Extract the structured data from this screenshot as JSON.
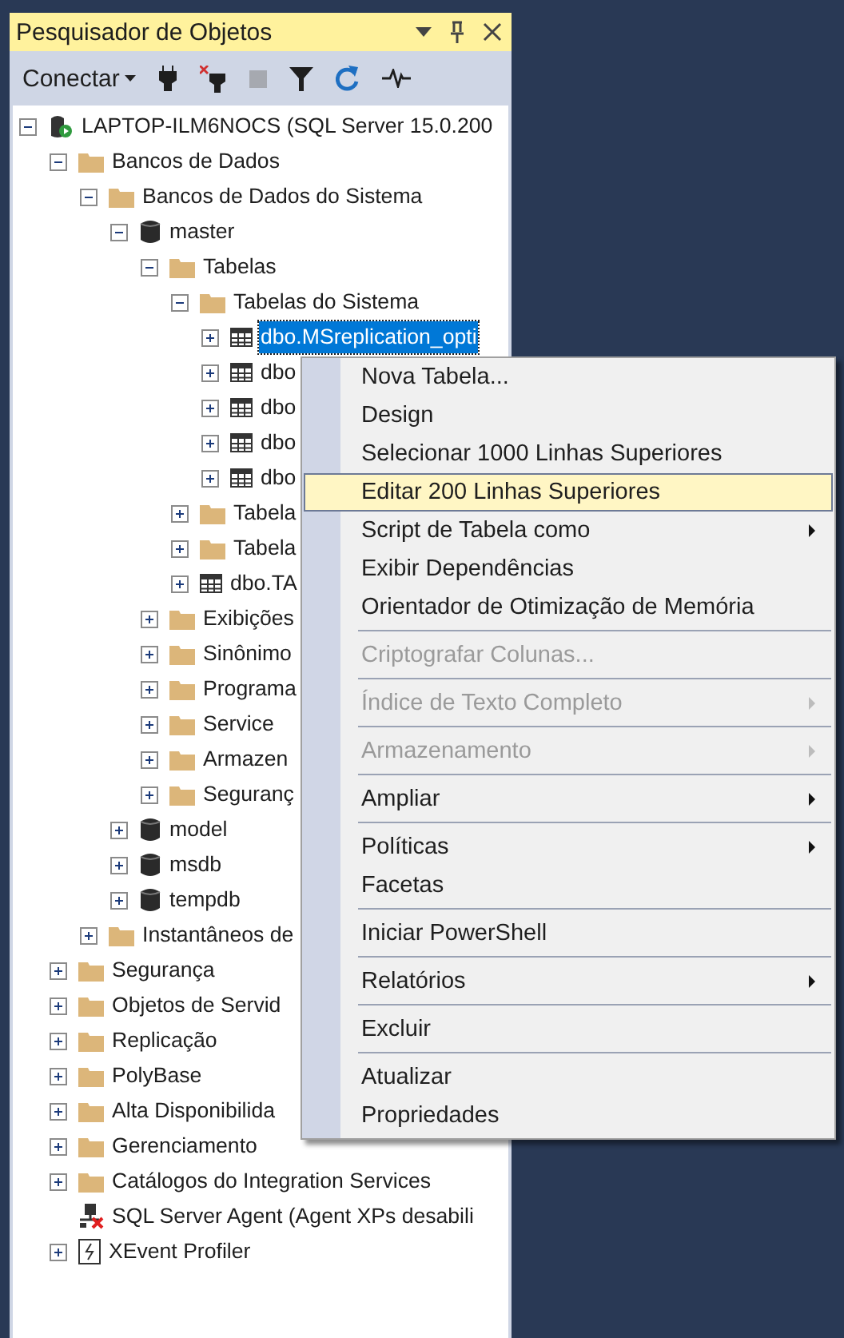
{
  "panel": {
    "title": "Pesquisador de Objetos"
  },
  "toolbar": {
    "connect_label": "Conectar",
    "tools": [
      {
        "kind": "plug"
      },
      {
        "kind": "unplug"
      },
      {
        "kind": "stop",
        "disabled": true
      },
      {
        "kind": "filter"
      },
      {
        "kind": "refresh"
      },
      {
        "kind": "activity"
      }
    ]
  },
  "tree": [
    {
      "label": "LAPTOP-ILM6NOCS (SQL Server 15.0.200",
      "kind": "server",
      "expanded": true,
      "selected": false,
      "children": [
        {
          "label": "Bancos de Dados",
          "kind": "folder",
          "expanded": true,
          "selected": false,
          "children": [
            {
              "label": "Bancos de Dados do Sistema",
              "kind": "folder",
              "expanded": true,
              "selected": false,
              "children": [
                {
                  "label": "master",
                  "kind": "database",
                  "expanded": true,
                  "selected": false,
                  "children": [
                    {
                      "label": "Tabelas",
                      "kind": "folder",
                      "expanded": true,
                      "selected": false,
                      "children": [
                        {
                          "label": "Tabelas do Sistema",
                          "kind": "folder",
                          "expanded": true,
                          "selected": false,
                          "children": [
                            {
                              "label": "dbo.MSreplication_opti",
                              "kind": "table",
                              "expanded": false,
                              "selected": true
                            },
                            {
                              "label": "dbo",
                              "kind": "table",
                              "expanded": false,
                              "selected": false
                            },
                            {
                              "label": "dbo",
                              "kind": "table",
                              "expanded": false,
                              "selected": false
                            },
                            {
                              "label": "dbo",
                              "kind": "table",
                              "expanded": false,
                              "selected": false
                            },
                            {
                              "label": "dbo",
                              "kind": "table",
                              "expanded": false,
                              "selected": false
                            }
                          ]
                        },
                        {
                          "label": "Tabela",
                          "kind": "folder",
                          "expanded": false,
                          "selected": false
                        },
                        {
                          "label": "Tabela",
                          "kind": "folder",
                          "expanded": false,
                          "selected": false
                        },
                        {
                          "label": "dbo.TA",
                          "kind": "table",
                          "expanded": false,
                          "selected": false
                        }
                      ]
                    },
                    {
                      "label": "Exibições",
                      "kind": "folder",
                      "expanded": false,
                      "selected": false
                    },
                    {
                      "label": "Sinônimo",
                      "kind": "folder",
                      "expanded": false,
                      "selected": false
                    },
                    {
                      "label": "Programa",
                      "kind": "folder",
                      "expanded": false,
                      "selected": false
                    },
                    {
                      "label": "Service",
                      "kind": "folder",
                      "expanded": false,
                      "selected": false
                    },
                    {
                      "label": "Armazen",
                      "kind": "folder",
                      "expanded": false,
                      "selected": false
                    },
                    {
                      "label": "Seguranç",
                      "kind": "folder",
                      "expanded": false,
                      "selected": false
                    }
                  ]
                },
                {
                  "label": "model",
                  "kind": "database",
                  "expanded": false,
                  "selected": false
                },
                {
                  "label": "msdb",
                  "kind": "database",
                  "expanded": false,
                  "selected": false
                },
                {
                  "label": "tempdb",
                  "kind": "database",
                  "expanded": false,
                  "selected": false
                }
              ]
            },
            {
              "label": "Instantâneos de",
              "kind": "folder",
              "expanded": false,
              "selected": false
            }
          ]
        },
        {
          "label": "Segurança",
          "kind": "folder",
          "expanded": false,
          "selected": false
        },
        {
          "label": "Objetos de Servid",
          "kind": "folder",
          "expanded": false,
          "selected": false
        },
        {
          "label": "Replicação",
          "kind": "folder",
          "expanded": false,
          "selected": false
        },
        {
          "label": "PolyBase",
          "kind": "folder",
          "expanded": false,
          "selected": false
        },
        {
          "label": "Alta Disponibilida",
          "kind": "folder",
          "expanded": false,
          "selected": false
        },
        {
          "label": "Gerenciamento",
          "kind": "folder",
          "expanded": false,
          "selected": false
        },
        {
          "label": "Catálogos do Integration Services",
          "kind": "folder",
          "expanded": false,
          "selected": false
        },
        {
          "label": "SQL Server Agent (Agent XPs desabili",
          "kind": "agent",
          "selected": false
        },
        {
          "label": "XEvent Profiler",
          "kind": "xevent",
          "expanded": false,
          "selected": false
        }
      ]
    }
  ],
  "context_menu": [
    {
      "kind": "item",
      "label": "Nova Tabela...",
      "selected": false,
      "disabled": false,
      "submenu": false
    },
    {
      "kind": "item",
      "label": "Design",
      "selected": false,
      "disabled": false,
      "submenu": false
    },
    {
      "kind": "item",
      "label": "Selecionar 1000 Linhas Superiores",
      "selected": false,
      "disabled": false,
      "submenu": false
    },
    {
      "kind": "item",
      "label": "Editar 200 Linhas Superiores",
      "selected": true,
      "disabled": false,
      "submenu": false
    },
    {
      "kind": "item",
      "label": "Script de Tabela como",
      "selected": false,
      "disabled": false,
      "submenu": true
    },
    {
      "kind": "item",
      "label": "Exibir Dependências",
      "selected": false,
      "disabled": false,
      "submenu": false
    },
    {
      "kind": "item",
      "label": "Orientador de Otimização de Memória",
      "selected": false,
      "disabled": false,
      "submenu": false
    },
    {
      "kind": "separator"
    },
    {
      "kind": "item",
      "label": "Criptografar Colunas...",
      "selected": false,
      "disabled": true,
      "submenu": false
    },
    {
      "kind": "separator"
    },
    {
      "kind": "item",
      "label": "Índice de Texto Completo",
      "selected": false,
      "disabled": true,
      "submenu": true
    },
    {
      "kind": "separator"
    },
    {
      "kind": "item",
      "label": "Armazenamento",
      "selected": false,
      "disabled": true,
      "submenu": true
    },
    {
      "kind": "separator"
    },
    {
      "kind": "item",
      "label": "Ampliar",
      "selected": false,
      "disabled": false,
      "submenu": true
    },
    {
      "kind": "separator"
    },
    {
      "kind": "item",
      "label": "Políticas",
      "selected": false,
      "disabled": false,
      "submenu": true
    },
    {
      "kind": "item",
      "label": "Facetas",
      "selected": false,
      "disabled": false,
      "submenu": false
    },
    {
      "kind": "separator"
    },
    {
      "kind": "item",
      "label": "Iniciar PowerShell",
      "selected": false,
      "disabled": false,
      "submenu": false
    },
    {
      "kind": "separator"
    },
    {
      "kind": "item",
      "label": "Relatórios",
      "selected": false,
      "disabled": false,
      "submenu": true
    },
    {
      "kind": "separator"
    },
    {
      "kind": "item",
      "label": "Excluir",
      "selected": false,
      "disabled": false,
      "submenu": false
    },
    {
      "kind": "separator"
    },
    {
      "kind": "item",
      "label": "Atualizar",
      "selected": false,
      "disabled": false,
      "submenu": false
    },
    {
      "kind": "item",
      "label": "Propriedades",
      "selected": false,
      "disabled": false,
      "submenu": false
    }
  ]
}
